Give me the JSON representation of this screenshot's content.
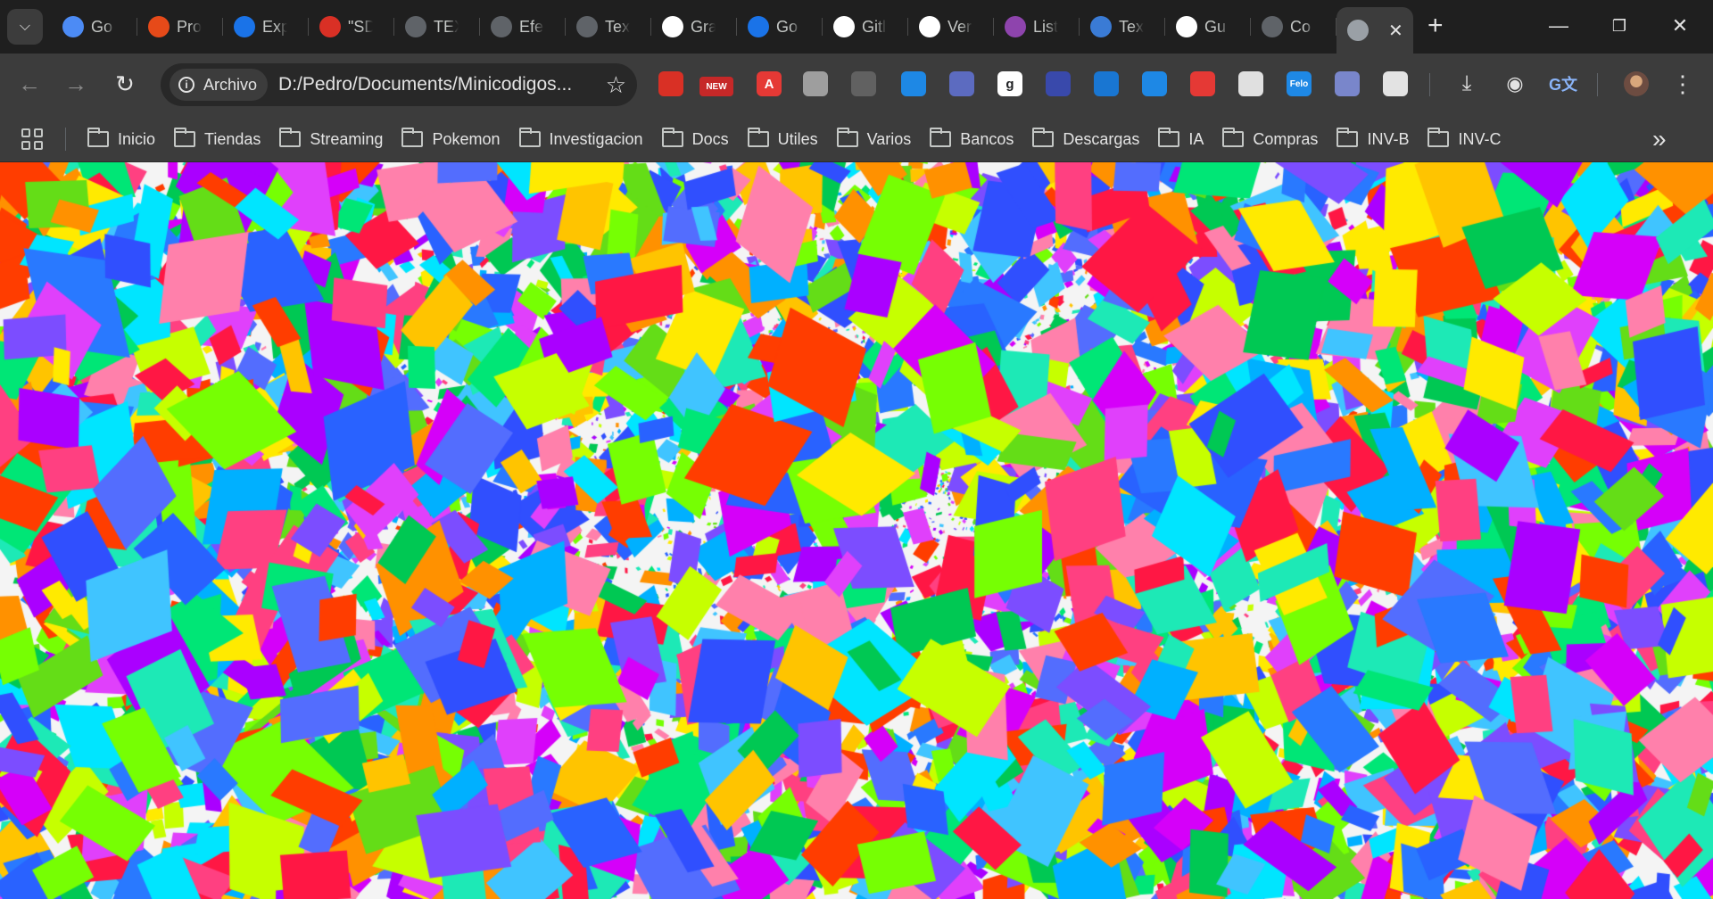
{
  "tabs": [
    {
      "label": "Go",
      "icon": "sparkle-icon",
      "color": "#4c8bf5"
    },
    {
      "label": "Pro",
      "icon": "rainbow-icon",
      "color": "#e64a19"
    },
    {
      "label": "Exp",
      "icon": "butterfly-icon",
      "color": "#1a73e8"
    },
    {
      "label": "\"SD",
      "icon": "calendar-50-icon",
      "color": "#d93025"
    },
    {
      "label": "TEX",
      "icon": "globe-icon",
      "color": "#5f6368"
    },
    {
      "label": "Efe",
      "icon": "globe-icon",
      "color": "#5f6368"
    },
    {
      "label": "Tex",
      "icon": "globe-icon",
      "color": "#5f6368"
    },
    {
      "label": "Gra",
      "icon": "wikipedia-icon",
      "color": "#ffffff"
    },
    {
      "label": "Go",
      "icon": "butterfly-icon",
      "color": "#1a73e8"
    },
    {
      "label": "Gitl",
      "icon": "github-icon",
      "color": "#ffffff"
    },
    {
      "label": "Ver",
      "icon": "github-icon",
      "color": "#ffffff"
    },
    {
      "label": "List",
      "icon": "vuetify-icon",
      "color": "#8e44ad"
    },
    {
      "label": "Tex",
      "icon": "tt-icon",
      "color": "#3a7bd5"
    },
    {
      "label": "Gu",
      "icon": "openai-icon",
      "color": "#ffffff"
    },
    {
      "label": "Co",
      "icon": "globe-icon",
      "color": "#5f6368"
    }
  ],
  "active_tab": {
    "icon": "globe-icon",
    "close_icon": "close-icon"
  },
  "omnibox": {
    "chip_label": "Archivo",
    "url": "D:/Pedro/Documents/Minicodigos..."
  },
  "extensions": [
    {
      "icon": "magic-wand-icon",
      "color": "#d93025",
      "label": ""
    },
    {
      "icon": "new-badge-icon",
      "color": "#c62828",
      "label": "NEW"
    },
    {
      "icon": "adblock-icon",
      "color": "#e53935",
      "label": "A"
    },
    {
      "icon": "bottle-icon",
      "color": "#9e9e9e",
      "label": ""
    },
    {
      "icon": "image-icon",
      "color": "#616161",
      "label": ""
    },
    {
      "icon": "download-arrow-icon",
      "color": "#1e88e5",
      "label": ""
    },
    {
      "icon": "translate-icon",
      "color": "#5c6bc0",
      "label": ""
    },
    {
      "icon": "grammarly-icon",
      "color": "#ffffff",
      "label": "g"
    },
    {
      "icon": "lock-icon",
      "color": "#3949ab",
      "label": ""
    },
    {
      "icon": "plus-cross-icon",
      "color": "#1976d2",
      "label": ""
    },
    {
      "icon": "screen-icon",
      "color": "#1e88e5",
      "label": ""
    },
    {
      "icon": "record-icon",
      "color": "#e53935",
      "label": ""
    },
    {
      "icon": "lines-icon",
      "color": "#e0e0e0",
      "label": ""
    },
    {
      "icon": "felo-icon",
      "color": "#1e88e5",
      "label": "Felo"
    },
    {
      "icon": "ghost-icon",
      "color": "#7986cb",
      "label": ""
    },
    {
      "icon": "puzzle-icon",
      "color": "#e3e3e3",
      "label": ""
    }
  ],
  "bookmarks": [
    "Inicio",
    "Tiendas",
    "Streaming",
    "Pokemon",
    "Investigacion",
    "Docs",
    "Utiles",
    "Varios",
    "Bancos",
    "Descargas",
    "IA",
    "Compras",
    "INV-B",
    "INV-C"
  ],
  "confetti_colors": [
    "#ff1744",
    "#ff4081",
    "#e040fb",
    "#d500f9",
    "#7c4dff",
    "#536dfe",
    "#2962ff",
    "#2979ff",
    "#00b0ff",
    "#00e5ff",
    "#1de9b6",
    "#00e676",
    "#76ff03",
    "#c6ff00",
    "#ffea00",
    "#ffc400",
    "#ff9100",
    "#ff3d00",
    "#aa00ff",
    "#304ffe",
    "#00c853",
    "#64dd17",
    "#ff80ab",
    "#40c4ff"
  ]
}
